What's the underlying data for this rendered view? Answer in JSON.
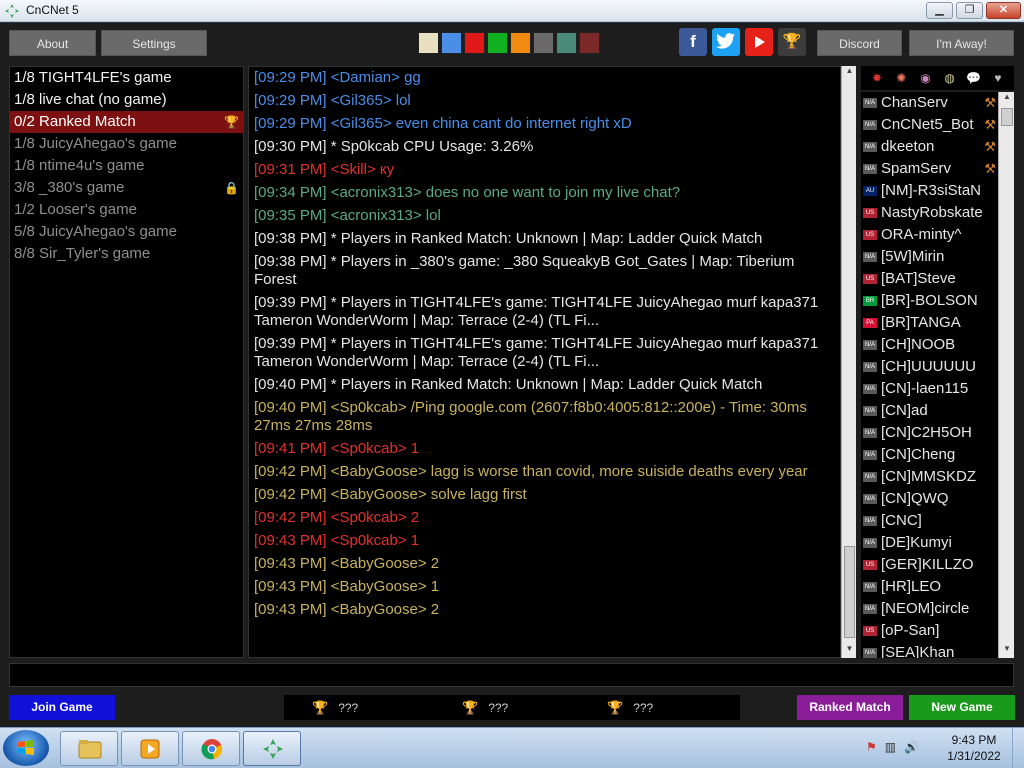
{
  "window": {
    "title": "CnCNet 5",
    "minimize": "▁",
    "maximize": "❐",
    "close": "✕"
  },
  "toolbar": {
    "about": "About",
    "settings": "Settings",
    "discord": "Discord",
    "away": "I'm Away!",
    "swatch_colors": [
      "#e8e0c0",
      "#4a8ee8",
      "#e01818",
      "#10b020",
      "#f08a10",
      "#6a6a6a",
      "#4a8a78",
      "#7a2828"
    ]
  },
  "games": [
    {
      "label": "1/8 TIGHT4LFE's game",
      "state": "active"
    },
    {
      "label": "1/8 live chat (no game)",
      "state": "active"
    },
    {
      "label": "0/2 Ranked Match",
      "state": "selected",
      "badge": "trophy-icon"
    },
    {
      "label": "1/8 JuicyAhegao's game",
      "state": "inactive"
    },
    {
      "label": "1/8 ntime4u's game",
      "state": "inactive"
    },
    {
      "label": "3/8 _380's game",
      "state": "inactive",
      "badge": "lock-icon"
    },
    {
      "label": "1/2 Looser's game",
      "state": "inactive"
    },
    {
      "label": "5/8 JuicyAhegao's game",
      "state": "inactive"
    },
    {
      "label": "8/8 Sir_Tyler's game",
      "state": "inactive"
    }
  ],
  "chat": [
    {
      "text": "[09:29 PM] <Damian> gg",
      "color": "blue"
    },
    {
      "text": "[09:29 PM] <Gil365> lol",
      "color": "blue"
    },
    {
      "text": "[09:29 PM] <Gil365> even china cant do internet right xD",
      "color": "blue"
    },
    {
      "text": "[09:30 PM] * Sp0kcab CPU Usage: 3.26%",
      "color": "white"
    },
    {
      "text": "[09:31 PM] <Skill> ку",
      "color": "red"
    },
    {
      "text": "[09:34 PM] <acronix313> does no one want to join my live chat?",
      "color": "green"
    },
    {
      "text": "[09:35 PM] <acronix313> lol",
      "color": "green"
    },
    {
      "text": "[09:38 PM] * Players in Ranked Match: Unknown | Map: Ladder Quick Match",
      "color": "white"
    },
    {
      "text": "[09:38 PM] * Players in _380's game: _380 SqueakyB Got_Gates | Map: Tiberium Forest",
      "color": "white"
    },
    {
      "text": "[09:39 PM] * Players in TIGHT4LFE's game: TIGHT4LFE JuicyAhegao murf kapa371 Tameron WonderWorm | Map: Terrace (2-4) (TL Fi...",
      "color": "white"
    },
    {
      "text": "[09:39 PM] * Players in TIGHT4LFE's game: TIGHT4LFE JuicyAhegao murf kapa371 Tameron WonderWorm | Map: Terrace (2-4) (TL Fi...",
      "color": "white"
    },
    {
      "text": "[09:40 PM] * Players in Ranked Match: Unknown | Map: Ladder Quick Match",
      "color": "white"
    },
    {
      "text": "[09:40 PM] <Sp0kcab> /Ping google.com (2607:f8b0:4005:812::200e) - Time: 30ms 27ms 27ms 28ms",
      "color": "olive"
    },
    {
      "text": "[09:41 PM] <Sp0kcab> 1",
      "color": "red"
    },
    {
      "text": "[09:42 PM] <BabyGoose> lagg is worse than covid, more suiside deaths every year",
      "color": "olive"
    },
    {
      "text": "[09:42 PM] <BabyGoose> solve lagg first",
      "color": "olive"
    },
    {
      "text": "[09:42 PM] <Sp0kcab> 2",
      "color": "red"
    },
    {
      "text": "[09:43 PM] <Sp0kcab> 1",
      "color": "red"
    },
    {
      "text": "[09:43 PM] <BabyGoose> 2",
      "color": "olive"
    },
    {
      "text": "[09:43 PM] <BabyGoose> 1",
      "color": "olive"
    },
    {
      "text": "[09:43 PM] <BabyGoose> 2",
      "color": "olive"
    }
  ],
  "user_filters": [
    "red-alert-icon",
    "explosion-icon",
    "eye-icon",
    "globe-icon",
    "speech-icon",
    "heart-icon"
  ],
  "users": [
    {
      "name": "ChanServ",
      "flag": "N/A",
      "op": true
    },
    {
      "name": "CnCNet5_Bot",
      "flag": "N/A",
      "op": true
    },
    {
      "name": "dkeeton",
      "flag": "N/A",
      "op": true
    },
    {
      "name": "SpamServ",
      "flag": "N/A",
      "op": true
    },
    {
      "name": "[NM]-R3siStaN",
      "flag": "AU"
    },
    {
      "name": "NastyRobskate",
      "flag": "US"
    },
    {
      "name": "ORA-minty^",
      "flag": "US"
    },
    {
      "name": "[5W]Mirin",
      "flag": "N/A"
    },
    {
      "name": "[BAT]Steve",
      "flag": "US"
    },
    {
      "name": "[BR]-BOLSON",
      "flag": "BR"
    },
    {
      "name": "[BR]TANGA",
      "flag": "PA"
    },
    {
      "name": "[CH]NOOB",
      "flag": "N/A"
    },
    {
      "name": "[CH]UUUUUU",
      "flag": "N/A"
    },
    {
      "name": "[CN]-laen115",
      "flag": "N/A"
    },
    {
      "name": "[CN]ad",
      "flag": "N/A"
    },
    {
      "name": "[CN]C2H5OH",
      "flag": "N/A"
    },
    {
      "name": "[CN]Cheng",
      "flag": "N/A"
    },
    {
      "name": "[CN]MMSKDZ",
      "flag": "N/A"
    },
    {
      "name": "[CN]QWQ",
      "flag": "N/A"
    },
    {
      "name": "[CNC]",
      "flag": "N/A"
    },
    {
      "name": "[DE]Kumyi",
      "flag": "N/A"
    },
    {
      "name": "[GER]KILLZO",
      "flag": "US"
    },
    {
      "name": "[HR]LEO",
      "flag": "N/A"
    },
    {
      "name": "[NEOM]circle",
      "flag": "N/A"
    },
    {
      "name": "[oP-San]",
      "flag": "US"
    },
    {
      "name": "[SEA]Khan",
      "flag": "N/A"
    }
  ],
  "bottom": {
    "join": "Join Game",
    "ranked": "Ranked Match",
    "new_game": "New Game",
    "ladder": [
      "???",
      "???",
      "???"
    ]
  },
  "taskbar": {
    "time": "9:43 PM",
    "date": "1/31/2022"
  }
}
